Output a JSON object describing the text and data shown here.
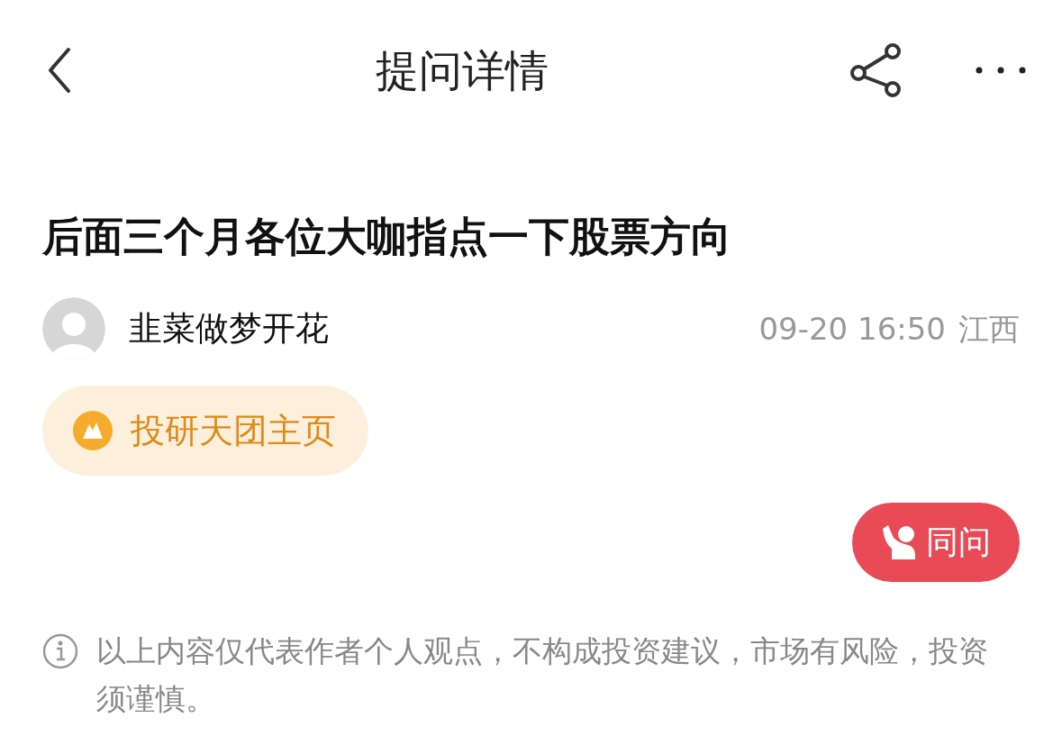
{
  "header": {
    "title": "提问详情"
  },
  "question": {
    "title": "后面三个月各位大咖指点一下股票方向"
  },
  "author": {
    "name": "韭菜做梦开花",
    "time": "09-20 16:50",
    "location": "江西"
  },
  "badge": {
    "label": "投研天团主页"
  },
  "same_question_button": {
    "label": "同问"
  },
  "disclaimer": "以上内容仅代表作者个人观点，不构成投资建议，市场有风险，投资须谨慎。"
}
